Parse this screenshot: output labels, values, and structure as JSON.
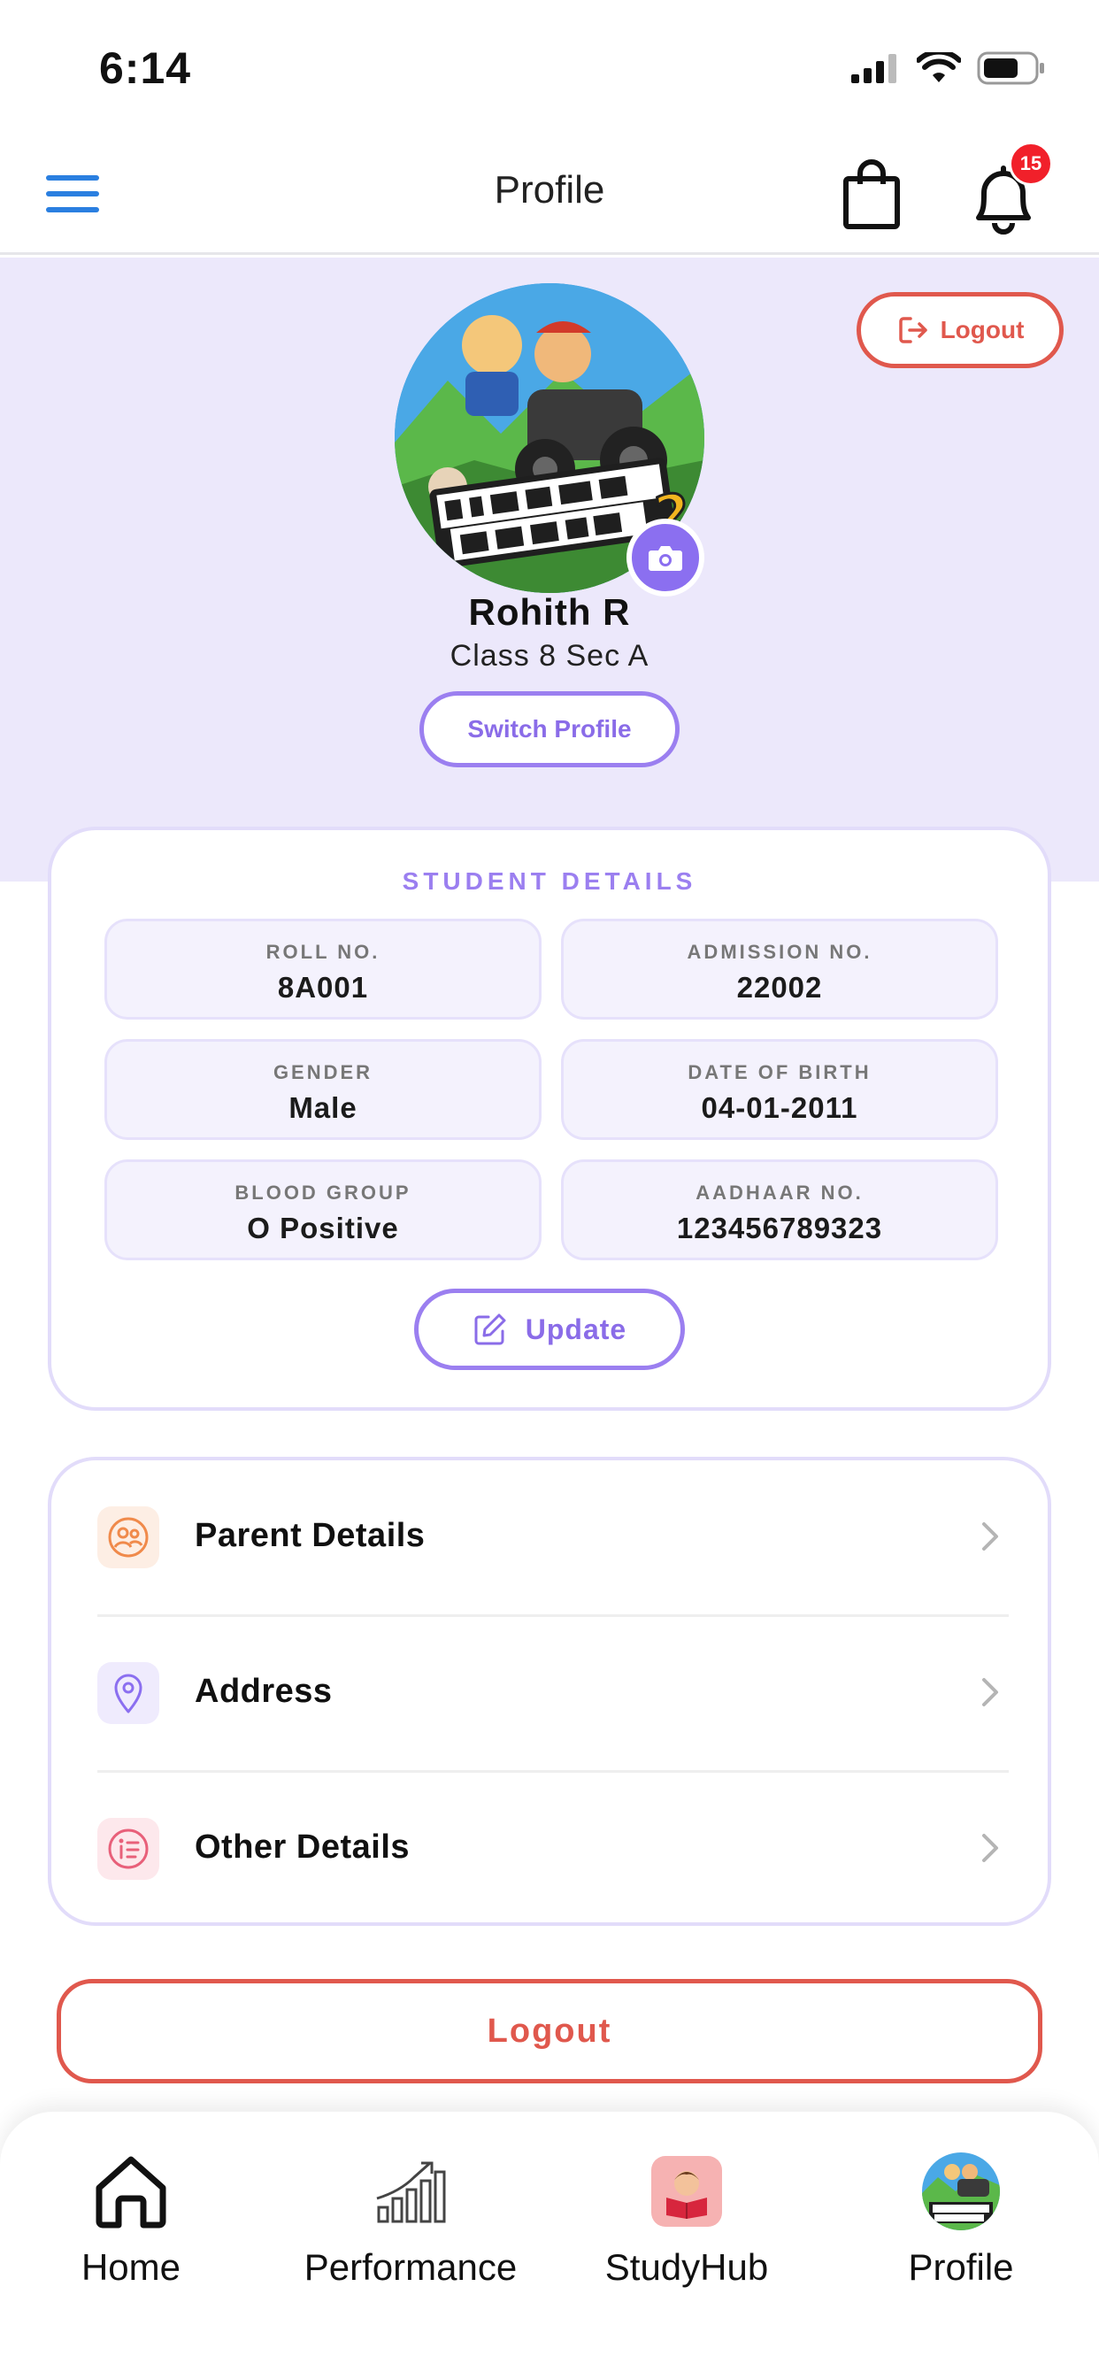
{
  "status_bar": {
    "time": "6:14"
  },
  "header": {
    "title": "Profile",
    "notification_count": "15"
  },
  "profile": {
    "logout_pill_label": "Logout",
    "name": "Rohith R",
    "class": "Class 8 Sec A",
    "switch_label": "Switch Profile"
  },
  "student_details": {
    "title": "STUDENT DETAILS",
    "fields": [
      {
        "label": "ROLL NO.",
        "value": "8A001"
      },
      {
        "label": "ADMISSION NO.",
        "value": "22002"
      },
      {
        "label": "GENDER",
        "value": "Male"
      },
      {
        "label": "DATE OF BIRTH",
        "value": "04-01-2011"
      },
      {
        "label": "BLOOD GROUP",
        "value": "O Positive"
      },
      {
        "label": "AADHAAR NO.",
        "value": "123456789323"
      }
    ],
    "update_label": "Update"
  },
  "menu": [
    {
      "label": "Parent Details",
      "icon": "parents-icon",
      "color": "#f08a4b"
    },
    {
      "label": "Address",
      "icon": "location-pin-icon",
      "color": "#8b6ff0"
    },
    {
      "label": "Other Details",
      "icon": "info-list-icon",
      "color": "#e8607a"
    }
  ],
  "logout_label": "Logout",
  "tabs": [
    {
      "label": "Home",
      "icon": "home-icon"
    },
    {
      "label": "Performance",
      "icon": "growth-chart-icon"
    },
    {
      "label": "StudyHub",
      "icon": "reading-boy-icon"
    },
    {
      "label": "Profile",
      "icon": "profile-avatar-icon"
    }
  ],
  "colors": {
    "accent": "#8b6ff0",
    "danger": "#e0584d",
    "hero_bg": "#ece8fb",
    "link_blue": "#2a7fe0"
  }
}
